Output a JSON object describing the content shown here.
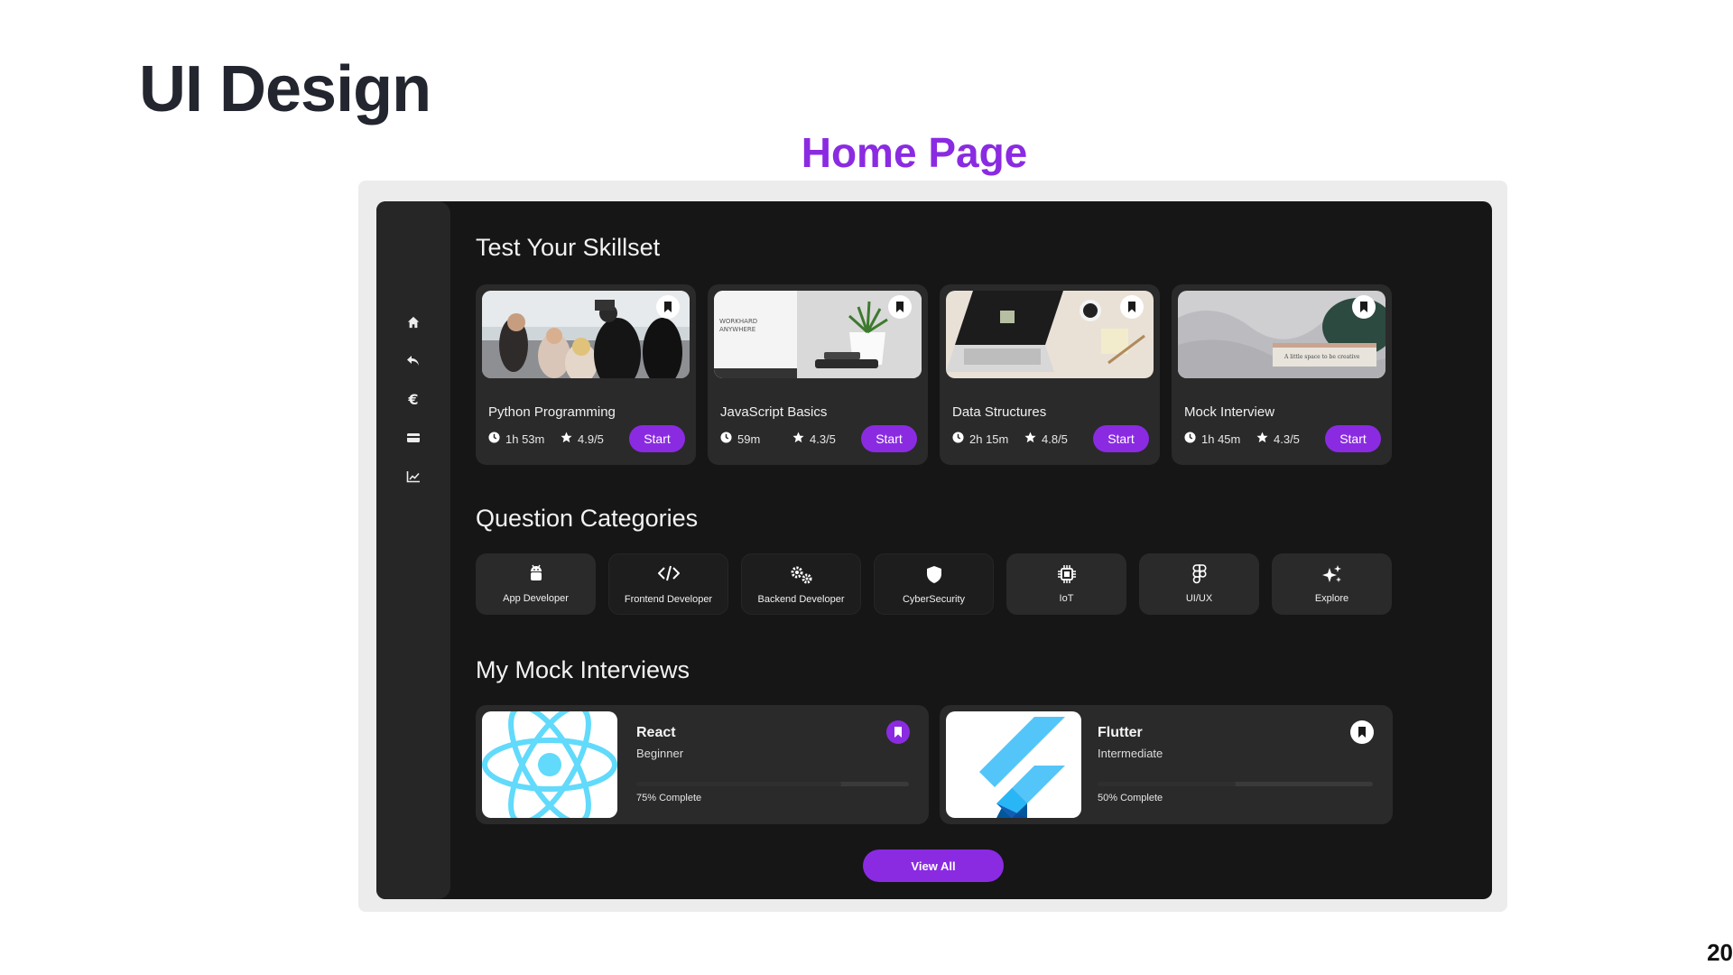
{
  "slide": {
    "title": "UI Design",
    "subtitle": "Home Page",
    "page_number": "20"
  },
  "sidebar": {
    "items": [
      {
        "icon": "home-icon"
      },
      {
        "icon": "reply-icon"
      },
      {
        "icon": "euro-icon"
      },
      {
        "icon": "credit-card-icon"
      },
      {
        "icon": "chart-line-icon"
      }
    ]
  },
  "skillset": {
    "title": "Test Your Skillset",
    "courses": [
      {
        "name": "Python Programming",
        "duration": "1h 53m",
        "rating": "4.9/5",
        "button": "Start"
      },
      {
        "name": "JavaScript Basics",
        "duration": "59m",
        "rating": "4.3/5",
        "button": "Start"
      },
      {
        "name": "Data Structures",
        "duration": "2h 15m",
        "rating": "4.8/5",
        "button": "Start"
      },
      {
        "name": "Mock Interview",
        "duration": "1h 45m",
        "rating": "4.3/5",
        "button": "Start"
      }
    ]
  },
  "categories": {
    "title": "Question Categories",
    "items": [
      {
        "label": "App Developer",
        "icon": "android-icon"
      },
      {
        "label": "Frontend Developer",
        "icon": "code-icon"
      },
      {
        "label": "Backend Developer",
        "icon": "gears-icon"
      },
      {
        "label": "CyberSecurity",
        "icon": "shield-icon"
      },
      {
        "label": "IoT",
        "icon": "chip-icon"
      },
      {
        "label": "UI/UX",
        "icon": "figma-icon"
      },
      {
        "label": "Explore",
        "icon": "sparkles-icon"
      }
    ]
  },
  "mock_interviews": {
    "title": "My Mock Interviews",
    "items": [
      {
        "name": "React",
        "level": "Beginner",
        "progress_text": "75% Complete",
        "progress": 0.75
      },
      {
        "name": "Flutter",
        "level": "Intermediate",
        "progress_text": "50% Complete",
        "progress": 0.5
      }
    ],
    "view_all": "View All"
  },
  "colors": {
    "accent": "#8a2be2",
    "background": "#161616",
    "card": "#2a2a2a",
    "sidebar": "#262626"
  }
}
